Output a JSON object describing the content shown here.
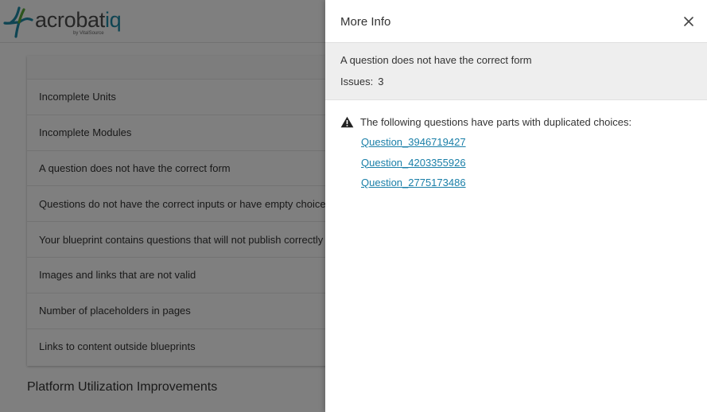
{
  "app": {
    "logo_text_main": "acrobat",
    "logo_text_accent": "iq",
    "logo_sub": "by VitalSource"
  },
  "background": {
    "check_items": [
      "Incomplete Units",
      "Incomplete Modules",
      "A question does not have the correct form",
      "Questions do not have the correct inputs or have empty choices",
      "Your blueprint contains questions that will not publish correctly",
      "Images and links that are not valid",
      "Number of placeholders in pages",
      "Links to content outside blueprints"
    ],
    "section_title": "Platform Utilization Improvements"
  },
  "drawer": {
    "title": "More Info",
    "close_icon": "close-icon",
    "summary": {
      "title": "A question does not have the correct form",
      "issues_label": "Issues:",
      "issues_count": "3"
    },
    "warning_icon": "warning-icon",
    "warning_text": "The following questions have parts with duplicated choices:",
    "questions": [
      "Question_3946719427",
      "Question_4203355926",
      "Question_2775173486"
    ]
  },
  "colors": {
    "link": "#1a7fa8",
    "logo_accent": "#1f8aa6",
    "summary_bg": "#eeeeee"
  }
}
